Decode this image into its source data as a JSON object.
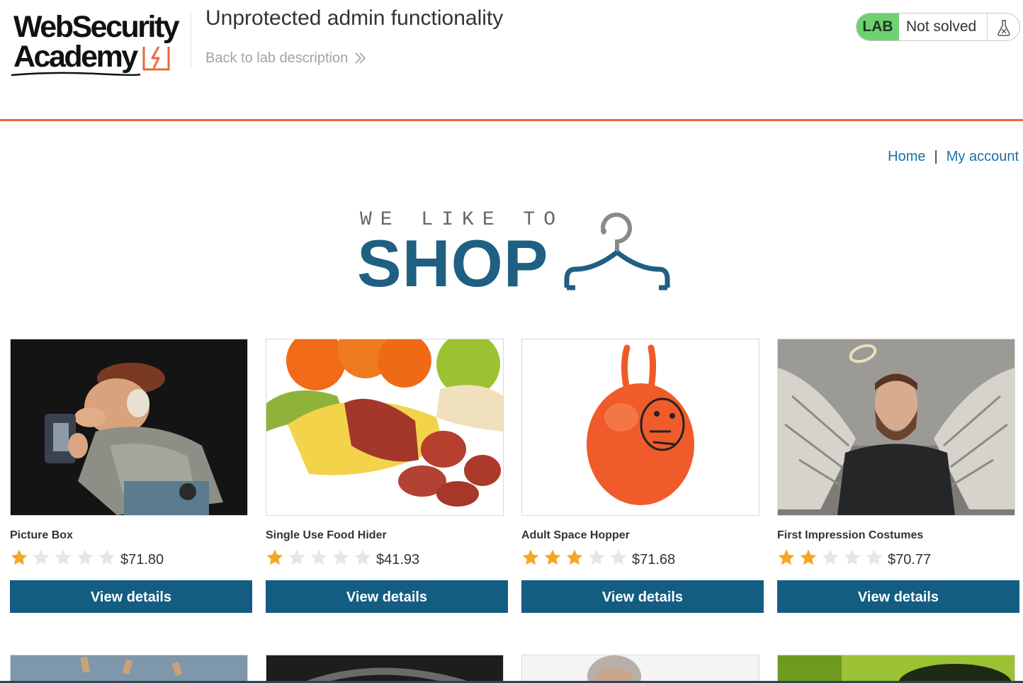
{
  "academy": {
    "logo_line1": "WebSecurity",
    "logo_line2": "Academy",
    "lab_title": "Unprotected admin functionality",
    "back_link": "Back to lab description",
    "lab_badge": "LAB",
    "lab_status": "Not solved"
  },
  "nav": {
    "home": "Home",
    "separator": "|",
    "my_account": "My account"
  },
  "hero": {
    "small": "WE LIKE TO",
    "big": "SHOP"
  },
  "products": [
    {
      "name": "Picture Box",
      "rating": 1,
      "max_rating": 5,
      "price": "$71.80",
      "button": "View details",
      "image": "cartoon-photographer-figurine"
    },
    {
      "name": "Single Use Food Hider",
      "rating": 1,
      "max_rating": 5,
      "price": "$41.93",
      "button": "View details",
      "image": "sausage-in-banana-peel"
    },
    {
      "name": "Adult Space Hopper",
      "rating": 3,
      "max_rating": 5,
      "price": "$71.68",
      "button": "View details",
      "image": "orange-space-hopper"
    },
    {
      "name": "First Impression Costumes",
      "rating": 2,
      "max_rating": 5,
      "price": "$70.77",
      "button": "View details",
      "image": "man-with-angel-wings"
    }
  ],
  "colors": {
    "accent_orange": "#e8693a",
    "link_blue": "#1d6fa5",
    "button_blue": "#135d82",
    "shop_blue": "#1f5f82",
    "lab_green": "#70d070",
    "star_filled": "#f5a623",
    "star_empty": "#e6e6e6"
  },
  "icons": {
    "back": "chevron-double-right-icon",
    "lab": "flask-icon",
    "star": "star-icon",
    "hero": "hanger-icon"
  }
}
